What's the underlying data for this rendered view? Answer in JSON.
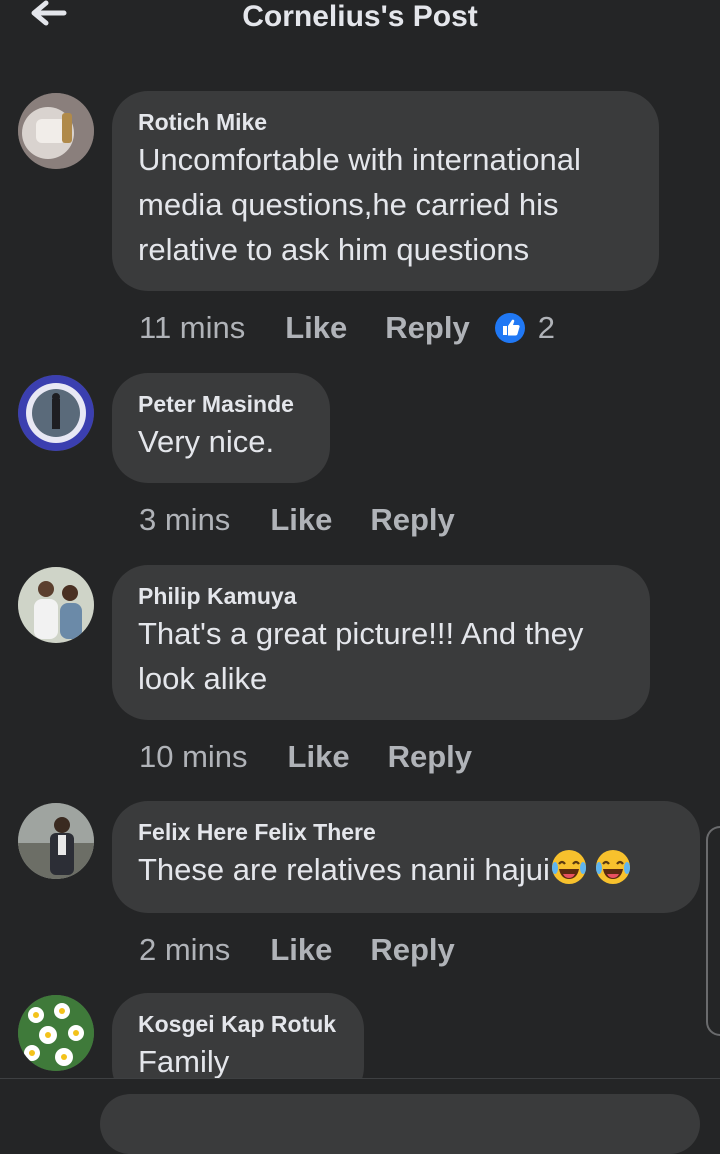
{
  "header": {
    "title": "Cornelius's Post",
    "back_icon": "arrow-left-icon"
  },
  "colors": {
    "background": "#242526",
    "bubble": "#3a3b3c",
    "text": "#e4e6eb",
    "muted": "#b0b3b8",
    "like_blue": "#2078f4"
  },
  "comments": [
    {
      "author": "Rotich Mike",
      "text": "Uncomfortable with international media questions,he carried his relative to ask him questions",
      "time": "11 mins",
      "like": "Like",
      "reply": "Reply",
      "reaction_icon": "like-reaction-icon",
      "reaction_count": "2"
    },
    {
      "author": "Peter Masinde",
      "text": "Very nice.",
      "time": "3 mins",
      "like": "Like",
      "reply": "Reply"
    },
    {
      "author": "Philip Kamuya",
      "text": "That's a great picture!!! And they look alike",
      "time": "10 mins",
      "like": "Like",
      "reply": "Reply"
    },
    {
      "author": "Felix Here Felix There",
      "text": "These are relatives nanii hajui",
      "emoji_icons": [
        "laughing-tears-emoji-icon",
        "laughing-tears-emoji-icon"
      ],
      "time": "2 mins",
      "like": "Like",
      "reply": "Reply"
    },
    {
      "author": "Kosgei Kap Rotuk",
      "text": "Family"
    }
  ]
}
